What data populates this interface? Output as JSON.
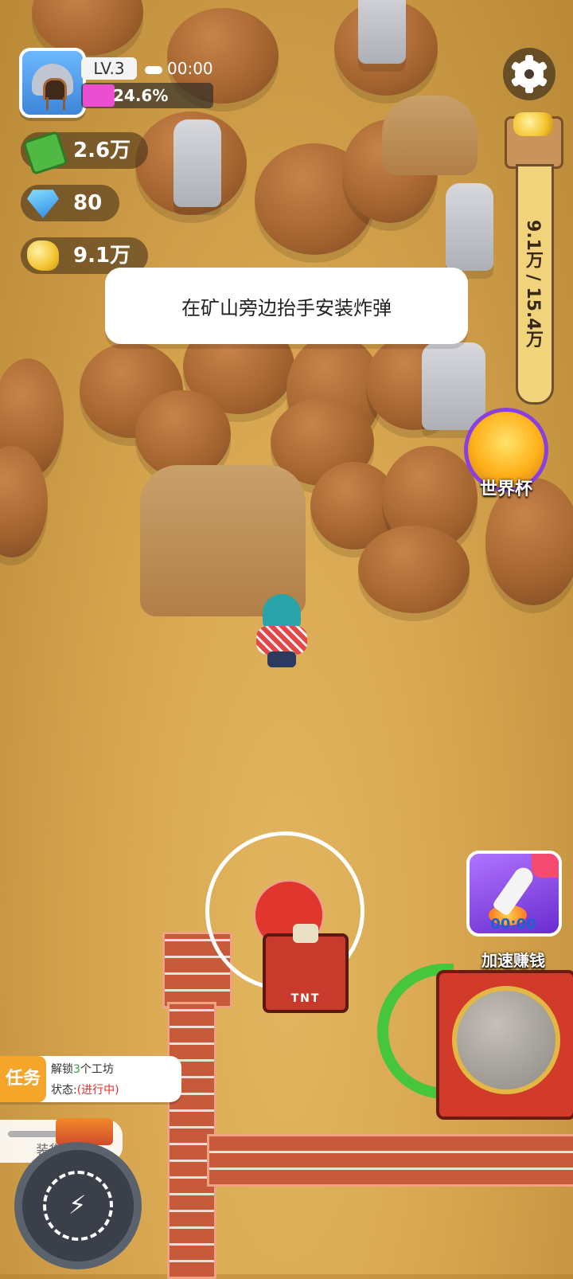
{
  "player": {
    "level": "LV.3",
    "timer": "00:00",
    "progress_percent": 24.6,
    "progress_text": "24.6%"
  },
  "resources": {
    "cash": "2.6万",
    "gems": "80",
    "gold": "9.1万"
  },
  "storage": {
    "text": "9.1万 / 15.4万",
    "current": 9.1,
    "capacity": 15.4
  },
  "tip": "在矿山旁边抬手安装炸弹",
  "world_cup": {
    "label": "世界杯"
  },
  "speed_up": {
    "timer": "00:00",
    "label": "加速赚钱"
  },
  "task": {
    "tag": "任务",
    "line1_prefix": "解锁",
    "line1_count": "3",
    "line1_suffix": "个工坊",
    "status_label": "状态:",
    "status_value": "(进行中)"
  },
  "loading": {
    "label": "装货中..."
  },
  "tnt": {
    "label": "TNT"
  },
  "icons": {
    "settings": "gear-icon",
    "cash": "cash-icon",
    "gems": "diamond-icon",
    "gold": "gold-nugget-icon",
    "weather": "cloud-icon",
    "power": "lightning-icon"
  },
  "colors": {
    "progress_fill": "#ec4ed1",
    "task_tag": "#f5a62a",
    "status_in_progress": "#e0302a",
    "task_count": "#3aa23a",
    "joystick_knob": "#e0362d"
  }
}
